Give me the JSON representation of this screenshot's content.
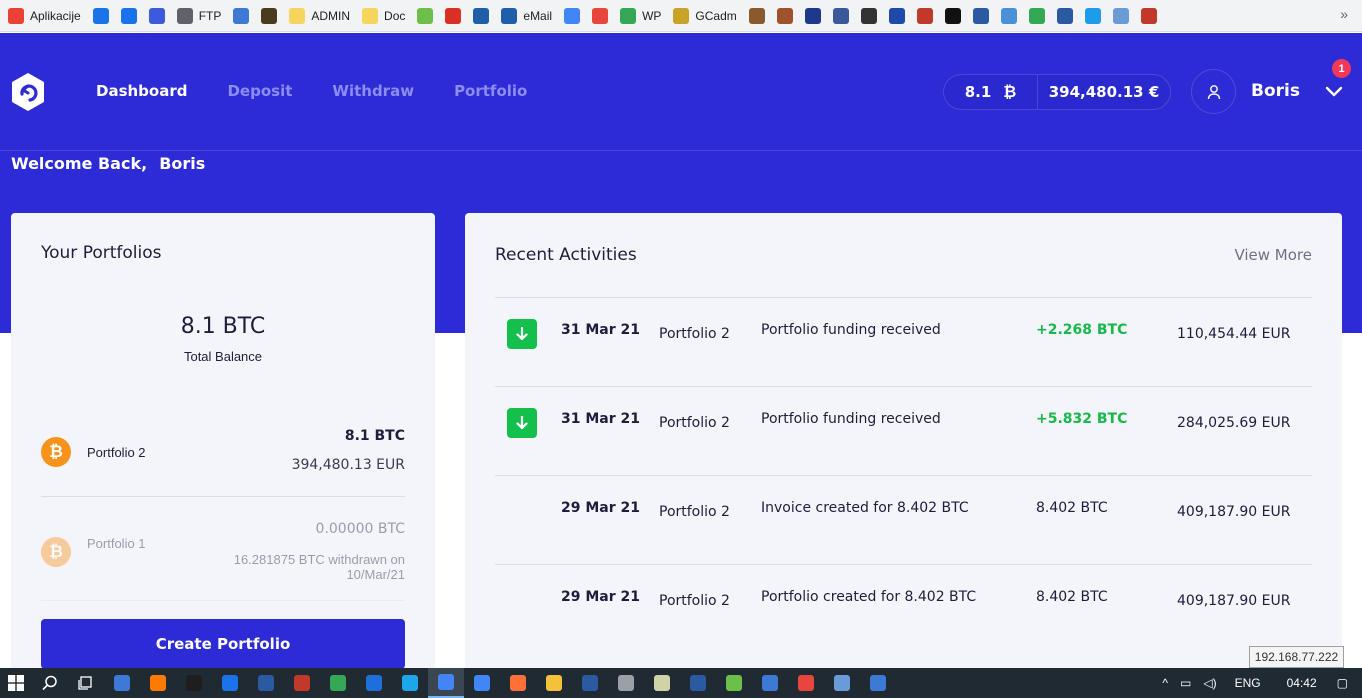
{
  "bookmarks": [
    {
      "label": "Aplikacije",
      "color": "#ea4335"
    },
    {
      "label": "",
      "color": "#1a73e8"
    },
    {
      "label": "",
      "color": "#1a73e8"
    },
    {
      "label": "",
      "color": "#3b5bdb"
    },
    {
      "label": "FTP",
      "color": "#5f6368"
    },
    {
      "label": "",
      "color": "#3c7ad6"
    },
    {
      "label": "",
      "color": "#4a3b1f"
    },
    {
      "label": "ADMIN",
      "color": "#f6d55c"
    },
    {
      "label": "Doc",
      "color": "#f6d55c"
    },
    {
      "label": "",
      "color": "#6cc04a"
    },
    {
      "label": "",
      "color": "#d93025"
    },
    {
      "label": "",
      "color": "#1f5fa8"
    },
    {
      "label": "eMail",
      "color": "#1f5fa8"
    },
    {
      "label": "",
      "color": "#4285f4"
    },
    {
      "label": "",
      "color": "#e8453c"
    },
    {
      "label": "WP",
      "color": "#34a853"
    },
    {
      "label": "GCadm",
      "color": "#c9a227"
    },
    {
      "label": "",
      "color": "#8a5a2b"
    },
    {
      "label": "",
      "color": "#a0522d"
    },
    {
      "label": "",
      "color": "#1d3a8a"
    },
    {
      "label": "",
      "color": "#3b5998"
    },
    {
      "label": "",
      "color": "#333333"
    },
    {
      "label": "",
      "color": "#1f4aa8"
    },
    {
      "label": "",
      "color": "#c0392b"
    },
    {
      "label": "",
      "color": "#111111"
    },
    {
      "label": "",
      "color": "#2c5aa0"
    },
    {
      "label": "",
      "color": "#4a90d9"
    },
    {
      "label": "",
      "color": "#34a853"
    },
    {
      "label": "",
      "color": "#2c5aa0"
    },
    {
      "label": "",
      "color": "#1e9be9"
    },
    {
      "label": "",
      "color": "#6a9bd8"
    },
    {
      "label": "",
      "color": "#c0392b"
    }
  ],
  "bookmarks_more": "»",
  "nav": {
    "items": [
      "Dashboard",
      "Deposit",
      "Withdraw",
      "Portfolio"
    ],
    "active": "Dashboard"
  },
  "balance": {
    "btc": "8.1",
    "btc_symbol": "₿",
    "eur": "394,480.13 €"
  },
  "user": {
    "name": "Boris",
    "notifications": "1"
  },
  "welcome": {
    "greeting": "Welcome Back,",
    "name": "Boris"
  },
  "portfolios": {
    "title": "Your Portfolios",
    "total_value": "8.1 BTC",
    "total_label": "Total Balance",
    "items": [
      {
        "name": "Portfolio 2",
        "btc": "8.1 BTC",
        "eur": "394,480.13 EUR",
        "note": ""
      },
      {
        "name": "Portfolio 1",
        "btc": "0.00000 BTC",
        "eur": "",
        "note": "16.281875 BTC withdrawn on 10/Mar/21"
      }
    ],
    "create_button": "Create Portfolio"
  },
  "activities": {
    "title": "Recent Activities",
    "view_more": "View More",
    "rows": [
      {
        "icon": "arrow-down-icon",
        "date": "31 Mar 21",
        "portfolio": "Portfolio 2",
        "description": "Portfolio funding received",
        "amount": "+2.268 BTC",
        "positive": true,
        "eur": "110,454.44 EUR"
      },
      {
        "icon": "arrow-down-icon",
        "date": "31 Mar 21",
        "portfolio": "Portfolio 2",
        "description": "Portfolio funding received",
        "amount": "+5.832 BTC",
        "positive": true,
        "eur": "284,025.69 EUR"
      },
      {
        "icon": "",
        "date": "29 Mar 21",
        "portfolio": "Portfolio 2",
        "description": "Invoice created for 8.402 BTC",
        "amount": "8.402 BTC",
        "positive": false,
        "eur": "409,187.90 EUR"
      },
      {
        "icon": "",
        "date": "29 Mar 21",
        "portfolio": "Portfolio 2",
        "description": "Portfolio created for 8.402 BTC",
        "amount": "8.402 BTC",
        "positive": false,
        "eur": "409,187.90 EUR"
      }
    ]
  },
  "tooltip": "192.168.77.222",
  "taskbar": {
    "apps": [
      "#3c7ad6",
      "#ff7a00",
      "#1e1e1e",
      "#1a73e8",
      "#2c5aa0",
      "#c0392b",
      "#34a853",
      "#1e6fd9",
      "#1ea7e8",
      "#4285f4",
      "#4285f4",
      "#ff7139",
      "#f6c13a",
      "#2c5aa0",
      "#9aa0a6",
      "#d2d2a8",
      "#2c5aa0",
      "#6cc04a",
      "#3c7ad6",
      "#e8453c",
      "#6a9bd8",
      "#3c7ad6"
    ],
    "active_index": 9,
    "tray": {
      "lang": "ENG",
      "time": "04:42"
    }
  },
  "colors": {
    "brand": "#2c2bd6",
    "positive": "#19b84a",
    "bitcoin": "#f7931a",
    "badge": "#f2385a"
  }
}
